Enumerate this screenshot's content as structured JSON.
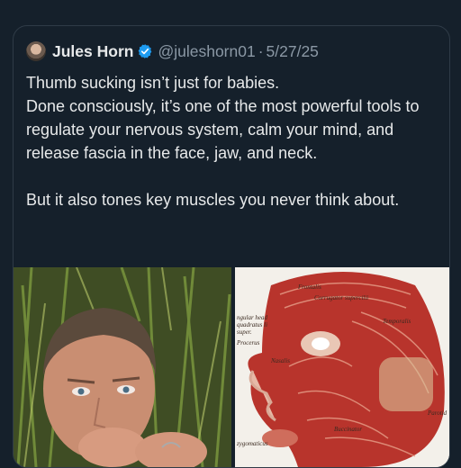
{
  "post": {
    "display_name": "Jules Horn",
    "handle": "@juleshorn01",
    "separator": "·",
    "date": "5/27/25",
    "paragraphs": [
      "Thumb sucking isn’t just for babies.",
      "Done consciously, it’s one of the most powerful tools to regulate your nervous system, calm your mind, and release fascia in the face, jaw, and neck.",
      "",
      "But it also tones key muscles you never think about."
    ]
  },
  "icons": {
    "verified": "verified-badge-icon",
    "avatar": "profile-avatar"
  },
  "media": {
    "left": "photo of man sucking thumb outdoors",
    "right_labels": {
      "top": "Frontalis",
      "corrugator": "Corrugator supercilii",
      "temporal": "Temporalis",
      "procerus": "Procerus",
      "nasalis": "Nasalis",
      "parotid": "Parotid",
      "buccinator": "Buccinator",
      "zygomaticus": "zygomaticus",
      "left_label": "ngular head quadratus li super."
    }
  },
  "colors": {
    "background": "#15202b",
    "text": "#e7e9ea",
    "muted": "#8b98a5",
    "verified": "#1d9bf0",
    "border": "#2f3b47"
  }
}
